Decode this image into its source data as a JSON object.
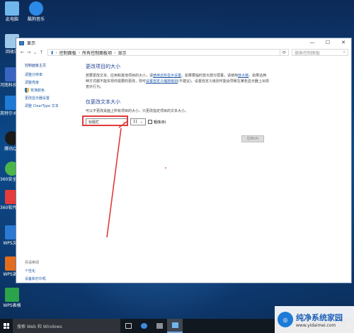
{
  "desktop": {
    "icons": [
      {
        "label": "此电脑",
        "icon": "computer-icon",
        "color": "#6fb7ec"
      },
      {
        "label": "酷狗音乐",
        "icon": "kugou-icon",
        "color": "#2c8ae6"
      },
      {
        "label": "回收站",
        "icon": "recycle-bin-icon",
        "color": "#9ec9e8"
      },
      {
        "label": "河南科技大学测",
        "icon": "app-icon",
        "color": "#3a64c2"
      },
      {
        "label": "英特尔®优化刊",
        "icon": "app-icon",
        "color": "#1f7bd6"
      },
      {
        "label": "腾讯QQ",
        "icon": "qq-icon",
        "color": "#1a1a1a"
      },
      {
        "label": "360安全卫士",
        "icon": "360-icon",
        "color": "#4bb54a"
      },
      {
        "label": "360软件管家",
        "icon": "360-software-icon",
        "color": "#e53b3b"
      },
      {
        "label": "WPS文字",
        "icon": "wps-writer-icon",
        "color": "#2b79d4"
      },
      {
        "label": "WPS演示",
        "icon": "wps-presentation-icon",
        "color": "#e36d1f"
      },
      {
        "label": "WPS表格",
        "icon": "wps-sheets-icon",
        "color": "#2aa34a"
      }
    ]
  },
  "window": {
    "title": "显示",
    "breadcrumb": [
      "控制面板",
      "所有控制面板项",
      "显示"
    ],
    "search_placeholder": "搜索控制面板",
    "sidebar": {
      "header": "控制面板主页",
      "links": [
        "调整分辨率",
        "调整亮度",
        "校准颜色",
        "更改显示器设置",
        "调整 ClearType 文本"
      ],
      "see_also": "另请参阅",
      "bottom_links": [
        "个性化",
        "设备和打印机"
      ]
    },
    "main": {
      "section1_title": "更改项目的大小",
      "section1_text_a": "若要更改文本、应用和其他项目的大小，请",
      "section1_link1": "使用这些显示设置",
      "section1_text_b": "。如果要临时放大部分屏幕，请使用",
      "section1_link2": "放大镜",
      "section1_text_c": "。如果这两种方式都不能实现你需要的更改，则可",
      "section1_link3": "设置自定义缩放级别",
      "section1_text_d": "(不建议)。设置自定义级别可能会导致在某些显示器上出现意外行为。",
      "section2_title": "仅更改文本大小",
      "section2_text": "可以不更改桌面上所有项目的大小，只更改指定项目的文本大小。",
      "item_select": "标题栏",
      "size_select": "11",
      "bold_label": "粗体(B)",
      "apply_label": "应用(A)"
    }
  },
  "taskbar": {
    "search_text": "搜索 Web 和 Windows"
  },
  "watermark": {
    "title": "纯净系统家园",
    "url": "www.yidaimei.com"
  }
}
